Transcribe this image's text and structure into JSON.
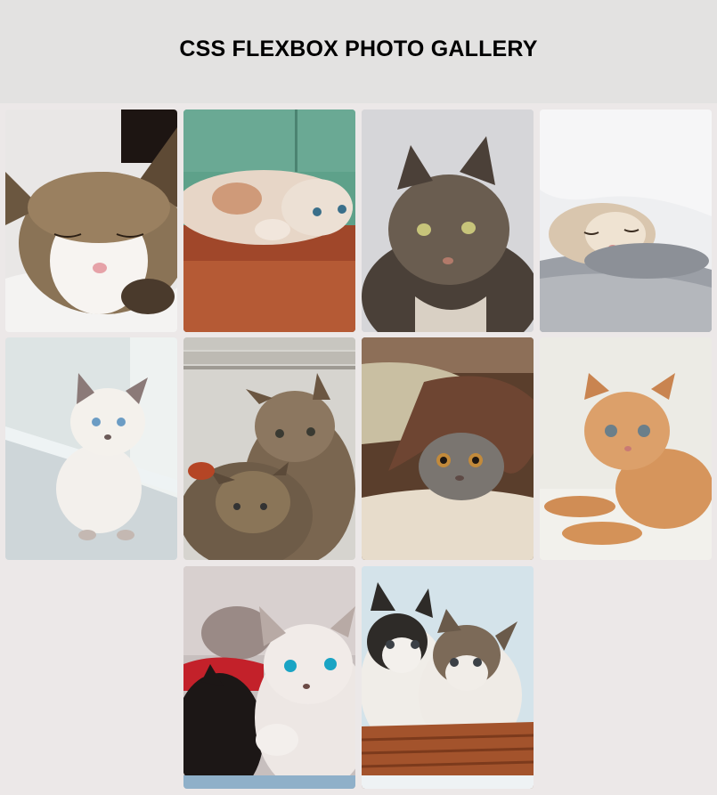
{
  "header": {
    "title": "CSS FLEXBOX PHOTO GALLERY"
  },
  "gallery": {
    "photos": [
      {
        "subject": "tabby-white kitten sleeping on white blanket"
      },
      {
        "subject": "ginger-white cat lying upside down on wooden floor"
      },
      {
        "subject": "long-haired tabby cat sitting"
      },
      {
        "subject": "cream kitten sleeping under white duvet"
      },
      {
        "subject": "white siamese kitten with blue eyes by window"
      },
      {
        "subject": "two tabby kittens together"
      },
      {
        "subject": "grey tabby cat hiding under brown blanket"
      },
      {
        "subject": "ginger kitten lying on white surface"
      },
      {
        "subject": "white kitten with blue eyes and black cat"
      },
      {
        "subject": "two kittens in wicker basket"
      }
    ]
  }
}
